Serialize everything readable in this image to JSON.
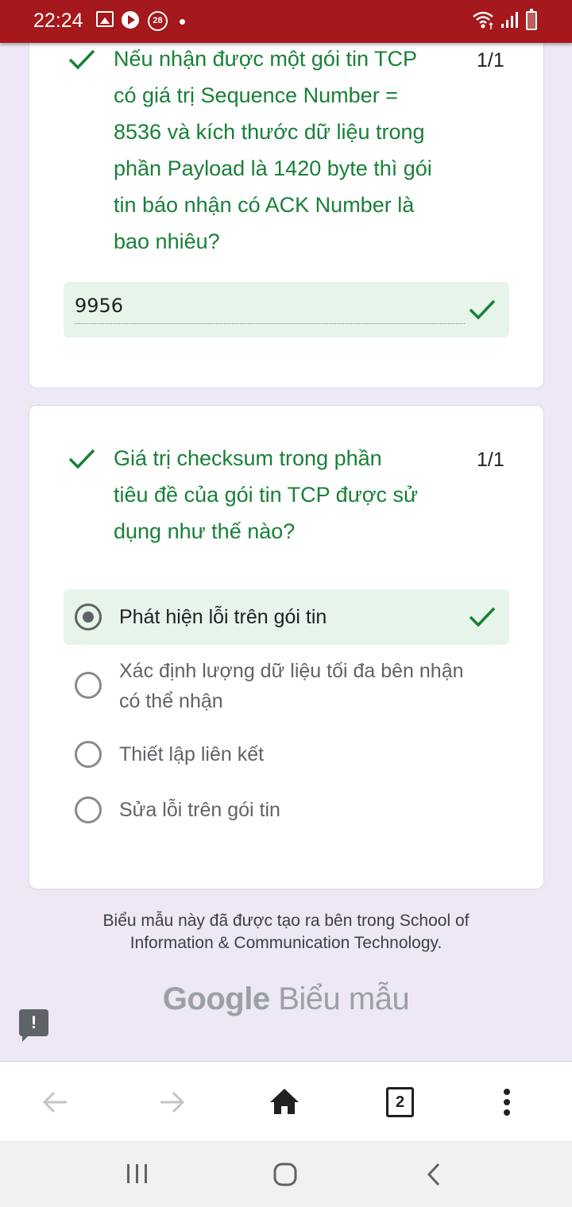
{
  "status_bar": {
    "time": "22:24",
    "notification_badge": "28",
    "icons": [
      "gallery-icon",
      "play-icon",
      "badge-icon",
      "dot-icon",
      "wifi-icon",
      "signal-icon",
      "battery-icon"
    ],
    "background_color": "#a5181b"
  },
  "question1": {
    "text": "Nếu nhận được một gói tin TCP có giá trị Sequence Number = 8536 và kích thước dữ liệu trong phần Payload là 1420 byte thì gói tin báo nhận có ACK Number là bao nhiêu?",
    "lines": [
      "Nếu nhận được một gói tin TCP",
      "có giá trị Sequence Number =",
      "8536 và kích thước dữ liệu trong",
      "phần Payload là 1420 byte thì gói",
      "tin báo nhận có ACK Number là",
      "bao nhiêu?"
    ],
    "score": "1/1",
    "answer": "9956",
    "correct": true
  },
  "question2": {
    "text": "Giá trị checksum trong phần tiêu đề của gói tin TCP được sử dụng như thế nào?",
    "lines": [
      "Giá trị checksum trong phần",
      "tiêu đề của gói tin TCP được sử",
      "dụng như thế nào?"
    ],
    "score": "1/1",
    "options": [
      {
        "label": "Phát hiện lỗi trên gói tin",
        "selected": true,
        "correct": true
      },
      {
        "label": "Xác định lượng dữ liệu tối đa bên nhận có thể nhận",
        "lines": [
          "Xác định lượng dữ liệu tối đa bên nhận",
          "có thể nhận"
        ],
        "selected": false
      },
      {
        "label": "Thiết lập liên kết",
        "selected": false
      },
      {
        "label": "Sửa lỗi trên gói tin",
        "selected": false
      }
    ]
  },
  "footer": {
    "line1": "Biểu mẫu này đã được tạo ra bên trong School of",
    "line2": "Information & Communication Technology.",
    "brand_google": "Google",
    "brand_product": "Biểu mẫu",
    "feedback_label": "!"
  },
  "browser_toolbar": {
    "tab_count": "2",
    "icons": [
      "back-arrow-icon",
      "forward-arrow-icon",
      "home-icon",
      "tabs-icon",
      "more-vert-icon"
    ]
  },
  "android_nav": {
    "icons": [
      "recents-icon",
      "home-button-icon",
      "back-button-icon"
    ]
  },
  "colors": {
    "correct_green": "#188038",
    "correct_bg": "#e6f4ea",
    "page_bg": "#ede7f6"
  }
}
